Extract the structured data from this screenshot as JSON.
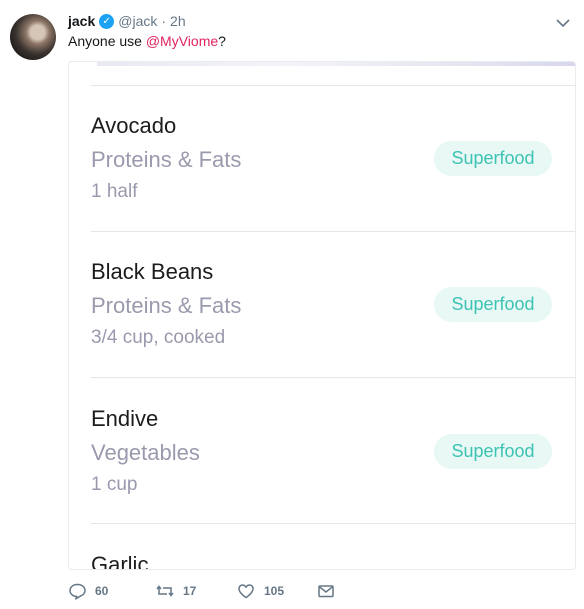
{
  "tweet": {
    "author_name": "jack",
    "handle": "@jack",
    "time": "2h",
    "text_prefix": "Anyone use ",
    "mention": "@MyViome",
    "text_suffix": "?"
  },
  "foods": [
    {
      "name": "Avocado",
      "category": "Proteins & Fats",
      "amount": "1 half",
      "badge": "Superfood"
    },
    {
      "name": "Black Beans",
      "category": "Proteins & Fats",
      "amount": "3/4 cup, cooked",
      "badge": "Superfood"
    },
    {
      "name": "Endive",
      "category": "Vegetables",
      "amount": "1 cup",
      "badge": "Superfood"
    },
    {
      "name": "Garlic"
    }
  ],
  "actions": {
    "replies": "60",
    "retweets": "17",
    "likes": "105"
  },
  "colors": {
    "mention": "#e0245e",
    "badge_text": "#3dc3b3",
    "badge_bg": "#e7f8f5",
    "verified": "#1da1f2"
  }
}
